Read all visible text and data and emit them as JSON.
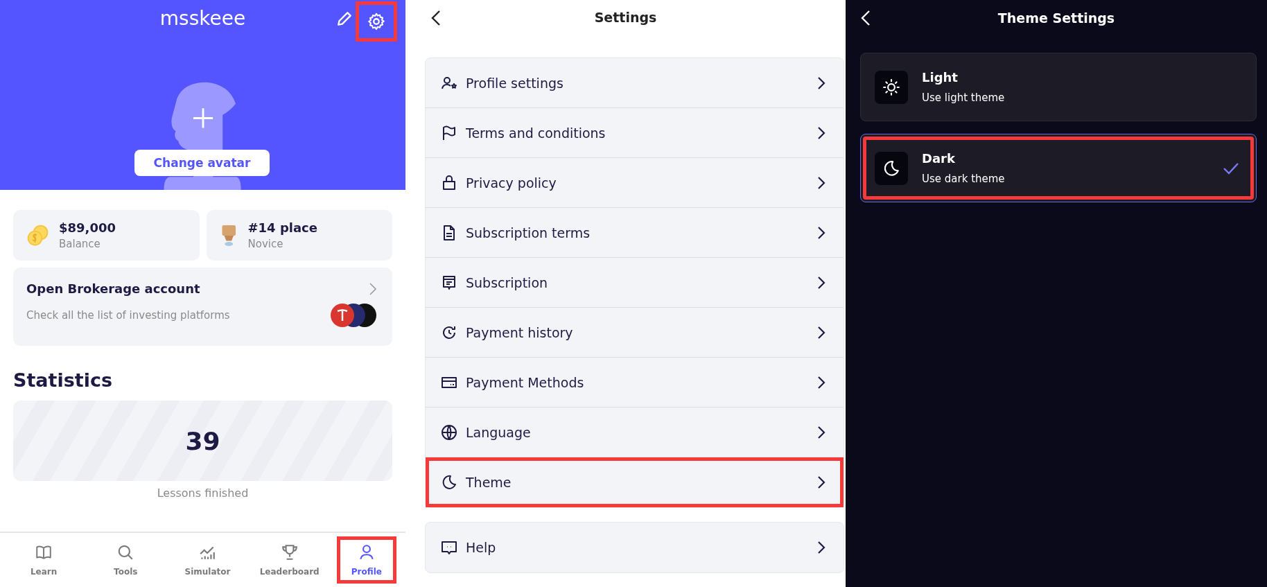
{
  "profile": {
    "username": "msskeee",
    "settings_highlighted": true,
    "avatar_button": "Change avatar",
    "stats": [
      {
        "kind": "coins",
        "value": "$89,000",
        "label": "Balance"
      },
      {
        "kind": "trophy",
        "value": "#14 place",
        "label": "Novice"
      }
    ],
    "brokerage": {
      "title": "Open Brokerage account",
      "subtitle": "Check all the list of investing platforms"
    },
    "statistics": {
      "heading": "Statistics",
      "value": "39",
      "label": "Lessons finished"
    },
    "nav": [
      {
        "kind": "book",
        "label": "Learn",
        "selected": false,
        "highlighted": false
      },
      {
        "kind": "search",
        "label": "Tools",
        "selected": false,
        "highlighted": false
      },
      {
        "kind": "chart",
        "label": "Simulator",
        "selected": false,
        "highlighted": false
      },
      {
        "kind": "trophy",
        "label": "Leaderboard",
        "selected": false,
        "highlighted": false
      },
      {
        "kind": "user",
        "label": "Profile",
        "selected": true,
        "highlighted": true
      }
    ]
  },
  "settings": {
    "title": "Settings",
    "groups": [
      {
        "items": [
          {
            "kind": "user-star",
            "label": "Profile settings",
            "highlighted": false
          },
          {
            "kind": "flag",
            "label": "Terms and conditions",
            "highlighted": false
          },
          {
            "kind": "lock",
            "label": "Privacy policy",
            "highlighted": false
          },
          {
            "kind": "document",
            "label": "Subscription terms",
            "highlighted": false
          },
          {
            "kind": "receipt",
            "label": "Subscription",
            "highlighted": false
          },
          {
            "kind": "history",
            "label": "Payment history",
            "highlighted": false
          },
          {
            "kind": "card",
            "label": "Payment Methods",
            "highlighted": false
          },
          {
            "kind": "globe",
            "label": "Language",
            "highlighted": false
          },
          {
            "kind": "moon",
            "label": "Theme",
            "highlighted": true
          }
        ]
      },
      {
        "items": [
          {
            "kind": "chat",
            "label": "Help",
            "highlighted": false
          }
        ]
      }
    ]
  },
  "theme_settings": {
    "title": "Theme Settings",
    "options": [
      {
        "kind": "sun",
        "label": "Light",
        "description": "Use light theme",
        "selected": false,
        "highlighted": false
      },
      {
        "kind": "moon",
        "label": "Dark",
        "description": "Use dark theme",
        "selected": true,
        "highlighted": true
      }
    ]
  }
}
